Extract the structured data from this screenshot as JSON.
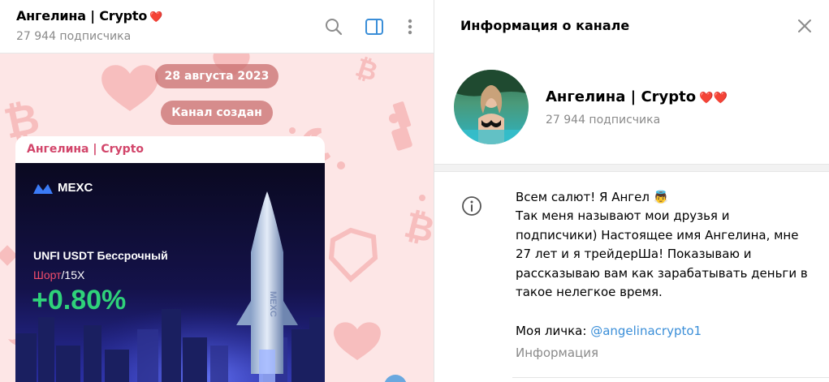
{
  "chat": {
    "title": "Ангелина | Crypto",
    "title_emoji": "❤️",
    "subscribers": "27 944 подписчика",
    "icons": [
      "search-icon",
      "side-panel-icon",
      "more-vertical-icon"
    ],
    "date_pill": "28 августа 2023",
    "service_pill": "Канал создан",
    "post": {
      "author": "Ангелина | Crypto",
      "media": {
        "logo": "MEXC",
        "pair": "UNFI USDT Бессрочный",
        "side": "Шорт",
        "leverage": "/15X",
        "change": "+0.80%",
        "rocket_label": "MEXC"
      }
    }
  },
  "info": {
    "header_title": "Информация о канале",
    "name": "Ангелина | Crypto",
    "name_emoji": "❤️❤️",
    "subscribers": "27 944 подписчика",
    "about_lines": [
      "Всем салют! Я Ангел 👼",
      "Так меня называют мои друзья и",
      "подписчики) Настоящее имя Ангелина, мне",
      "27 лет и я трейдерШа! Показываю и",
      "рассказываю вам как зарабатывать деньги в",
      "такое нелегкое время."
    ],
    "contact_prefix": "Моя личка: ",
    "contact_link": "@angelinacrypto1",
    "about_label": "Информация"
  },
  "colors": {
    "accent_link": "#3a8ed8",
    "author_pink": "#d2456a",
    "chat_bg": "#fde6e6",
    "pill_bg": "#c86e6e",
    "gain_green": "#2fd27a",
    "short_red": "#f24d6b"
  }
}
